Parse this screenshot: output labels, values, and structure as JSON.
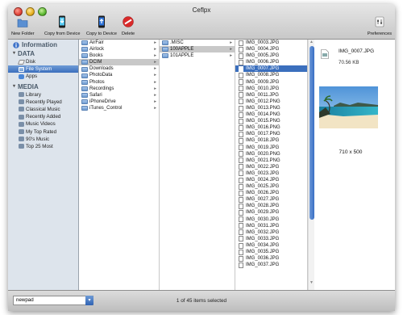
{
  "window": {
    "title": "Ceflpx"
  },
  "toolbar": {
    "new_folder": "New Folder",
    "copy_from_device": "Copy from Device",
    "copy_to_device": "Copy to Device",
    "delete": "Delete",
    "preferences": "Preferences"
  },
  "sidebar": {
    "information": "Information",
    "data_header": "DATA",
    "data_items": [
      "Disk",
      "File System",
      "Apps"
    ],
    "media_header": "MEDIA",
    "media_items": [
      "Library",
      "Recently Played",
      "Classical Music",
      "Recently Added",
      "Music Videos",
      "My Top Rated",
      "90's Music",
      "Top 25 Most"
    ]
  },
  "columns": {
    "col1": [
      "AirFair",
      "Airlock",
      "Books",
      "DCIM",
      "Downloads",
      "PhotoData",
      "Photos",
      "Recordings",
      "Safari",
      "iPhoneDrive",
      "iTunes_Control"
    ],
    "col2": [
      ".MISC",
      "100APPLE",
      "101APPLE"
    ],
    "col3": [
      "IMG_0003.JPG",
      "IMG_0004.JPG",
      "IMG_0005.JPG",
      "IMG_0006.JPG",
      "IMG_0007.JPG",
      "IMG_0008.JPG",
      "IMG_0009.JPG",
      "IMG_0010.JPG",
      "IMG_0011.JPG",
      "IMG_0012.PNG",
      "IMG_0013.PNG",
      "IMG_0014.PNG",
      "IMG_0015.PNG",
      "IMG_0016.PNG",
      "IMG_0017.PNG",
      "IMG_0018.JPG",
      "IMG_0019.JPG",
      "IMG_0020.PNG",
      "IMG_0021.PNG",
      "IMG_0022.JPG",
      "IMG_0023.JPG",
      "IMG_0024.JPG",
      "IMG_0025.JPG",
      "IMG_0026.JPG",
      "IMG_0027.JPG",
      "IMG_0028.JPG",
      "IMG_0029.JPG",
      "IMG_0030.JPG",
      "IMG_0031.JPG",
      "IMG_0032.JPG",
      "IMG_0033.JPG",
      "IMG_0034.JPG",
      "IMG_0035.JPG",
      "IMG_0036.JPG",
      "IMG_0037.JPG"
    ]
  },
  "preview": {
    "filename": "IMG_0007.JPG",
    "size": "70.56 KB",
    "dimensions": "710 x 500"
  },
  "status": {
    "device": "newpad",
    "text": "1 of 45 items selected"
  },
  "colors": {
    "selection": "#3b6fbd",
    "sidebar_bg": "#dde4ec"
  }
}
